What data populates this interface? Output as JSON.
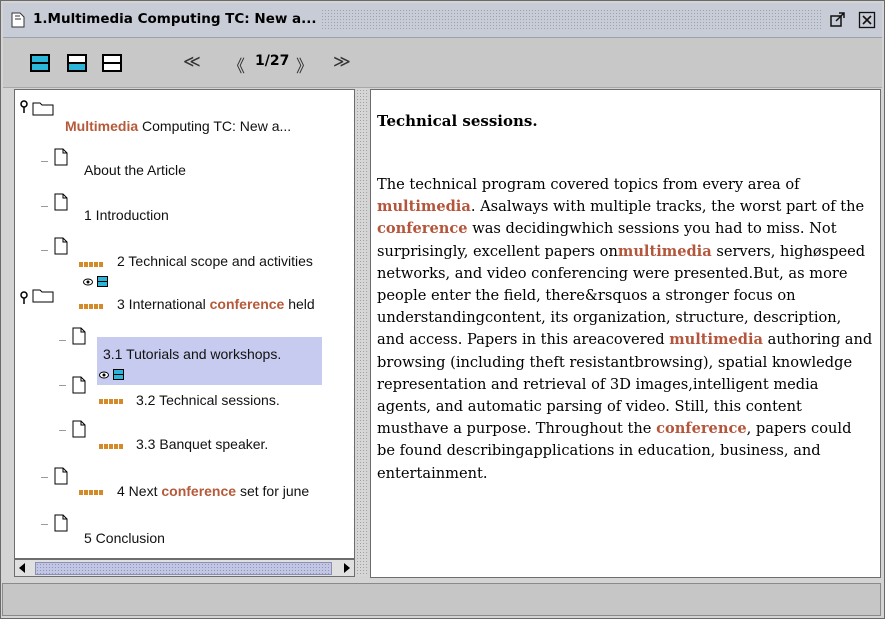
{
  "window": {
    "title": "1.Multimedia Computing TC: New a..."
  },
  "toolbar": {
    "page_indicator": "1/27",
    "first_label": "≪",
    "prev_label": "《",
    "next_label": "》",
    "last_label": "≫"
  },
  "tree": {
    "root": {
      "hl": "Multimedia",
      "rest": " Computing TC: New a..."
    },
    "about": "About the Article",
    "intro": "1 Introduction",
    "tech_scope": "2 Technical scope and activities",
    "intl_pre": "3 International ",
    "intl_hl": "conference",
    "intl_post": " held",
    "tutorials": "3.1 Tutorials and workshops.",
    "tech_sessions": "3.2 Technical sessions.",
    "banquet": "3.3 Banquet speaker.",
    "next_pre": "4 Next ",
    "next_hl": "conference",
    "next_post": " set for june",
    "conclusion": "5 Conclusion"
  },
  "content": {
    "heading": "Technical sessions.",
    "p1": "The technical program covered topics from every area of ",
    "h1": "multimedia",
    "p2": ". Asalways with multiple tracks, the worst part of the ",
    "h2": "conference",
    "p3": " was decidingwhich sessions you had to miss. Not surprisingly, excellent papers on",
    "h3": "multimedia",
    "p4": " servers, highøspeed networks, and video conferencing were presented.But, as more people enter the field, there&rsquos a stronger focus on understandingcontent, its organization, structure, description, and access. Papers in this areacovered ",
    "h4": "multimedia",
    "p5": " authoring and browsing (including theft resistantbrowsing), spatial knowledge representation and retrieval of 3D images,intelligent media agents, and automatic parsing of video. Still, this content musthave a purpose. Throughout the ",
    "h5": "conference",
    "p6": ", papers could be found describingapplications in education, business, and entertainment."
  },
  "colors": {
    "highlight": "#b55a3a",
    "relevance": "#d58a2a",
    "selection": "#c7cbef",
    "layout_icon": "#2bb5d8"
  }
}
